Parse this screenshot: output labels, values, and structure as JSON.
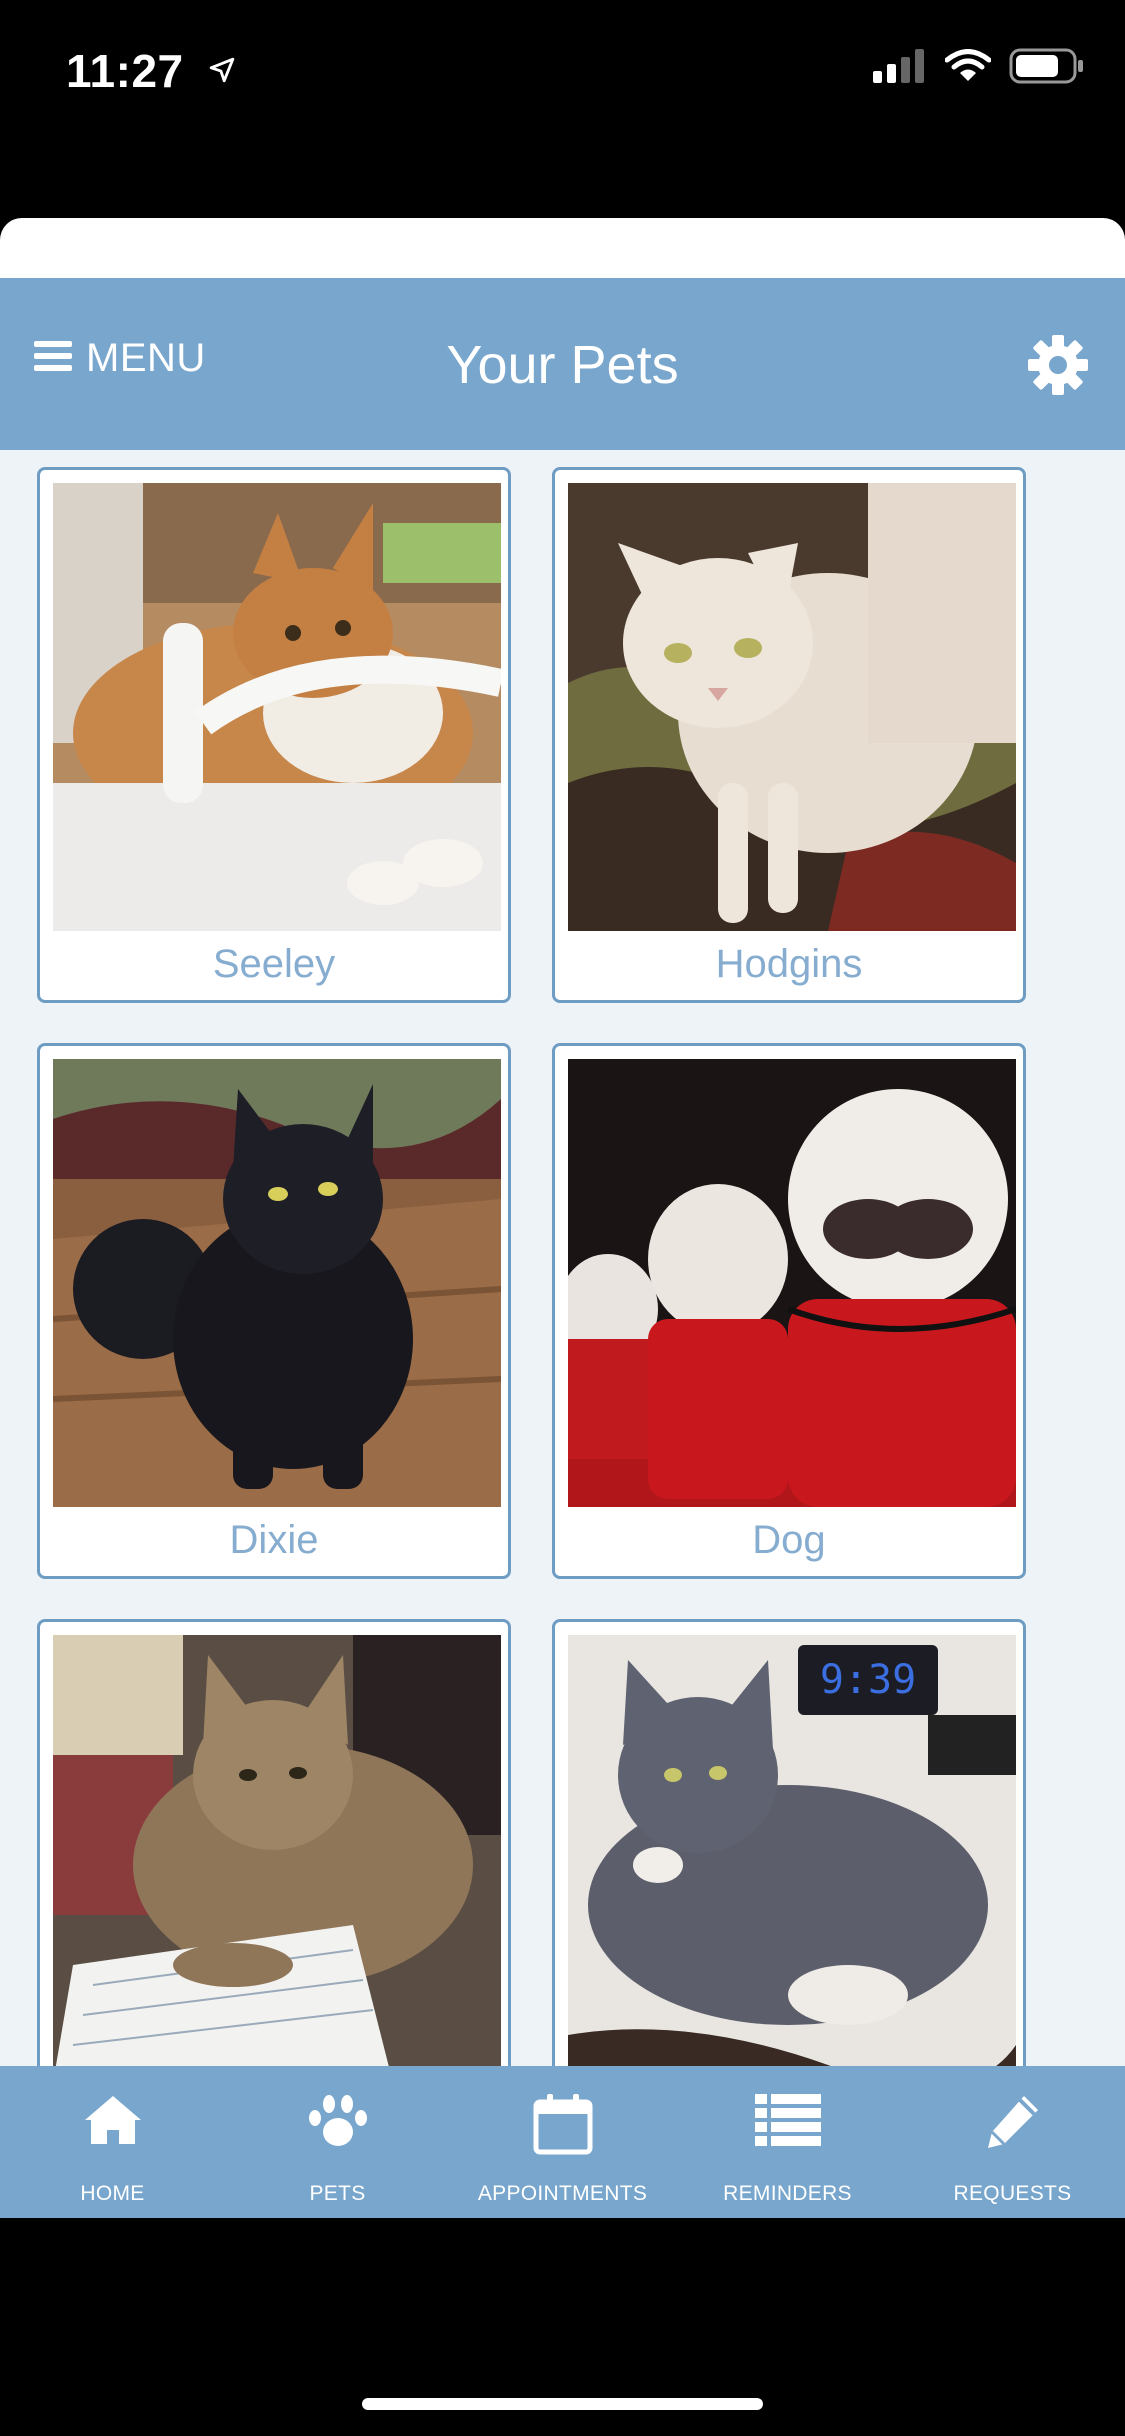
{
  "status_bar": {
    "time": "11:27",
    "icons": [
      "location-arrow-icon",
      "cellular-signal-icon",
      "wifi-icon",
      "battery-icon"
    ]
  },
  "header": {
    "menu_label": "MENU",
    "title": "Your Pets",
    "menu_icon": "hamburger-icon",
    "settings_icon": "gear-icon"
  },
  "pets": [
    {
      "name": "Seeley"
    },
    {
      "name": "Hodgins"
    },
    {
      "name": "Dixie"
    },
    {
      "name": "Dog"
    },
    {
      "name": ""
    },
    {
      "name": ""
    }
  ],
  "tabs": [
    {
      "label": "HOME",
      "icon": "home-icon"
    },
    {
      "label": "PETS",
      "icon": "paw-icon"
    },
    {
      "label": "APPOINTMENTS",
      "icon": "calendar-icon"
    },
    {
      "label": "REMINDERS",
      "icon": "list-icon"
    },
    {
      "label": "REQUESTS",
      "icon": "pencil-icon"
    }
  ],
  "colors": {
    "header": "#78a6cd",
    "tabbar": "#78a6cd",
    "card_border": "#6e9cc2",
    "pet_name": "#86acd0",
    "content_bg": "#eef3f8"
  }
}
